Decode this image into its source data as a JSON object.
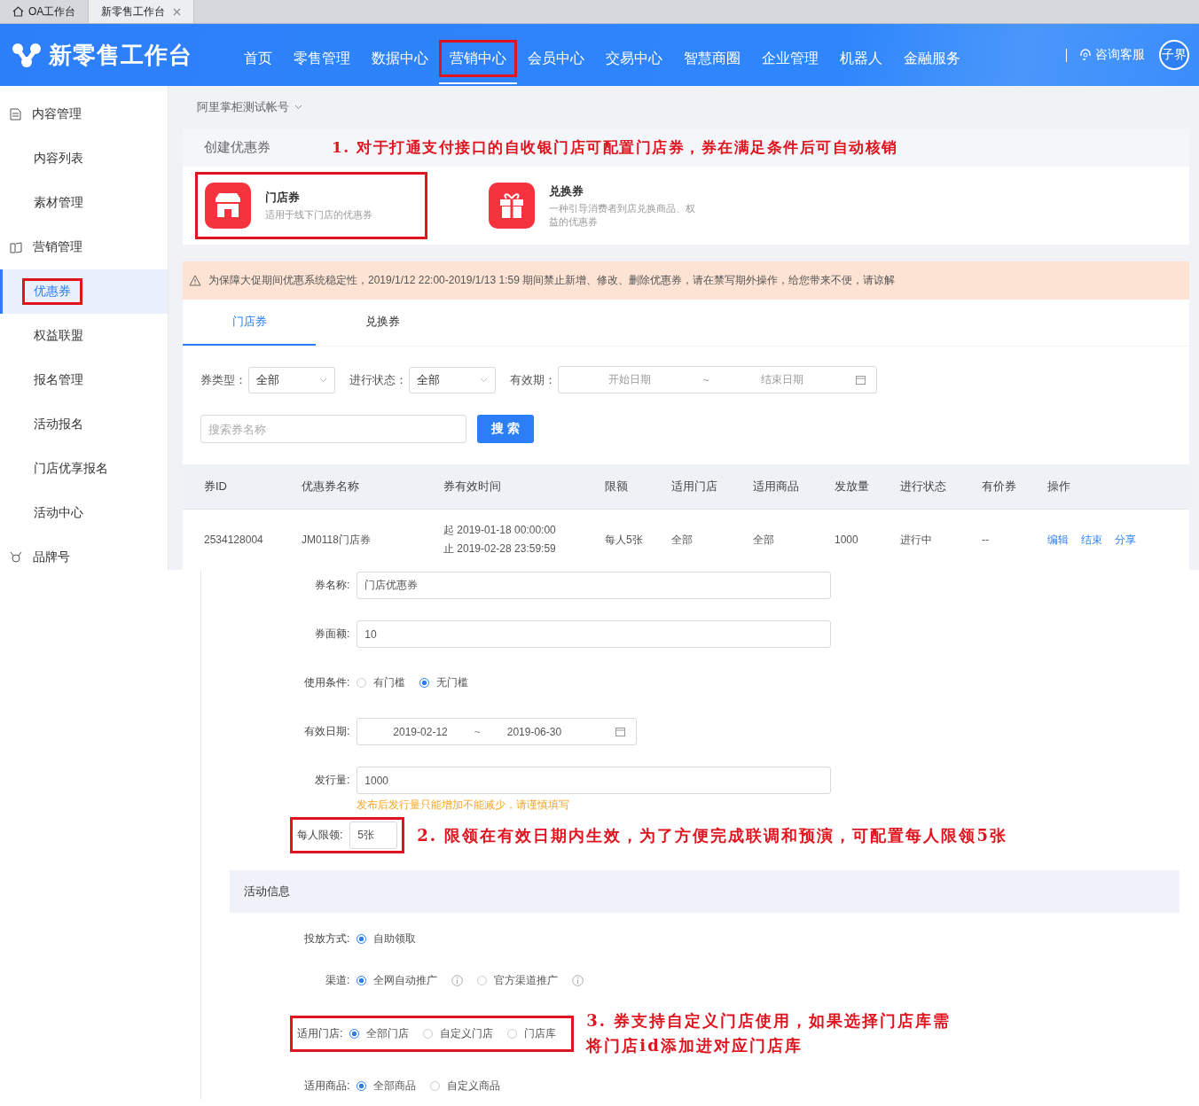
{
  "browser_tabs": [
    {
      "label": "OA工作台",
      "selected": false,
      "kind": "home"
    },
    {
      "label": "新零售工作台",
      "selected": true,
      "kind": "closable"
    }
  ],
  "header": {
    "title": "新零售工作台",
    "nav": [
      {
        "label": "首页",
        "selected": false,
        "boxed": false
      },
      {
        "label": "零售管理",
        "selected": false,
        "boxed": false
      },
      {
        "label": "数据中心",
        "selected": false,
        "boxed": false
      },
      {
        "label": "营销中心",
        "selected": true,
        "boxed": true
      },
      {
        "label": "会员中心",
        "selected": false,
        "boxed": false
      },
      {
        "label": "交易中心",
        "selected": false,
        "boxed": false
      },
      {
        "label": "智慧商圈",
        "selected": false,
        "boxed": false
      },
      {
        "label": "企业管理",
        "selected": false,
        "boxed": false
      },
      {
        "label": "机器人",
        "selected": false,
        "boxed": false
      },
      {
        "label": "金融服务",
        "selected": false,
        "boxed": false
      }
    ],
    "support": "咨询客服",
    "avatar": "子界"
  },
  "sidebar": {
    "items": [
      {
        "label": "内容管理",
        "kind": "group",
        "selected": false,
        "boxed": false
      },
      {
        "label": "内容列表",
        "kind": "item",
        "selected": false,
        "boxed": false
      },
      {
        "label": "素材管理",
        "kind": "item",
        "selected": false,
        "boxed": false
      },
      {
        "label": "营销管理",
        "kind": "group",
        "selected": false,
        "boxed": false
      },
      {
        "label": "优惠券",
        "kind": "item",
        "selected": true,
        "boxed": true
      },
      {
        "label": "权益联盟",
        "kind": "item",
        "selected": false,
        "boxed": false
      },
      {
        "label": "报名管理",
        "kind": "item",
        "selected": false,
        "boxed": false
      },
      {
        "label": "活动报名",
        "kind": "item",
        "selected": false,
        "boxed": false
      },
      {
        "label": "门店优享报名",
        "kind": "item",
        "selected": false,
        "boxed": false
      },
      {
        "label": "活动中心",
        "kind": "item",
        "selected": false,
        "boxed": false
      },
      {
        "label": "品牌号",
        "kind": "group",
        "selected": false,
        "boxed": false
      }
    ]
  },
  "account": "阿里掌柜测试帐号",
  "create_coupon": {
    "title": "创建优惠券",
    "note": "1. 对于打通支付接口的自收银门店可配置门店券，券在满足条件后可自动核销",
    "types": [
      {
        "name": "门店券",
        "description": "适用于线下门店的优惠券",
        "boxed": true
      },
      {
        "name": "兑换券",
        "description": "一种引导消费者到店兑换商品、权益的优惠券",
        "boxed": false
      }
    ]
  },
  "notice": "为保障大促期间优惠系统稳定性，2019/1/12 22:00-2019/1/13 1:59 期间禁止新增、修改、删除优惠券，请在禁写期外操作，给您带来不便，请谅解",
  "tabs": [
    {
      "label": "门店券",
      "selected": true
    },
    {
      "label": "兑换券",
      "selected": false
    }
  ],
  "filters": [
    {
      "kind": "select",
      "label": "券类型：",
      "value": "全部"
    },
    {
      "kind": "select",
      "label": "进行状态：",
      "value": "全部"
    },
    {
      "kind": "daterange",
      "label": "有效期：",
      "start_placeholder": "开始日期",
      "separator": "~",
      "end_placeholder": "结束日期"
    }
  ],
  "search": {
    "placeholder": "搜索券名称",
    "button": "搜 索"
  },
  "table": {
    "columns": [
      "券ID",
      "优惠券名称",
      "券有效时间",
      "限额",
      "适用门店",
      "适用商品",
      "发放量",
      "进行状态",
      "有价券",
      "操作"
    ],
    "rows": [
      {
        "id": "2534128004",
        "name": "JM0118门店券",
        "valid_from": "起 2019-01-18 00:00:00",
        "valid_to": "止 2019-02-28 23:59:59",
        "limit": "每人5张",
        "stores": "全部",
        "goods": "全部",
        "quantity": "1000",
        "status": "进行中",
        "priced": "--",
        "actions": [
          "编辑",
          "结束",
          "分享"
        ]
      }
    ]
  },
  "coupon_form": {
    "fields": [
      {
        "kind": "input",
        "label": "券名称:",
        "value": "门店优惠券",
        "boxed": false
      },
      {
        "kind": "input",
        "label": "券面额:",
        "value": "10",
        "boxed": false
      },
      {
        "kind": "radio",
        "label": "使用条件:",
        "boxed": false,
        "options": [
          {
            "label": "有门槛",
            "selected": false,
            "info": false
          },
          {
            "label": "无门槛",
            "selected": true,
            "info": false
          }
        ]
      },
      {
        "kind": "daterange",
        "label": "有效日期:",
        "start": "2019-02-12",
        "separator": "~",
        "end": "2019-06-30",
        "boxed": false
      },
      {
        "kind": "input",
        "label": "发行量:",
        "value": "1000",
        "hint": "发布后发行量只能增加不能减少，请谨慎填写",
        "boxed": false
      },
      {
        "kind": "input",
        "label": "每人限领:",
        "value": "5张",
        "boxed": true,
        "note": [
          "2. 限领在有效日期内生效，为了方便完成联调和预演，可配置每人限领5张"
        ]
      }
    ]
  },
  "activity": {
    "title": "活动信息",
    "fields": [
      {
        "kind": "radio",
        "label": "投放方式:",
        "boxed": false,
        "options": [
          {
            "label": "自助领取",
            "selected": true,
            "info": false
          }
        ]
      },
      {
        "kind": "radio",
        "label": "渠道:",
        "boxed": false,
        "options": [
          {
            "label": "全网自动推广",
            "selected": true,
            "info": true
          },
          {
            "label": "官方渠道推广",
            "selected": false,
            "info": true
          }
        ]
      },
      {
        "kind": "radio",
        "label": "适用门店:",
        "boxed": true,
        "note": [
          "3. 券支持自定义门店使用，如果选择门店库需",
          "将门店id添加进对应门店库"
        ],
        "options": [
          {
            "label": "全部门店",
            "selected": true,
            "info": false
          },
          {
            "label": "自定义门店",
            "selected": false,
            "info": false
          },
          {
            "label": "门店库",
            "selected": false,
            "info": false
          }
        ]
      },
      {
        "kind": "radio",
        "label": "适用商品:",
        "boxed": false,
        "options": [
          {
            "label": "全部商品",
            "selected": true,
            "info": false
          },
          {
            "label": "自定义商品",
            "selected": false,
            "info": false
          }
        ]
      }
    ]
  }
}
